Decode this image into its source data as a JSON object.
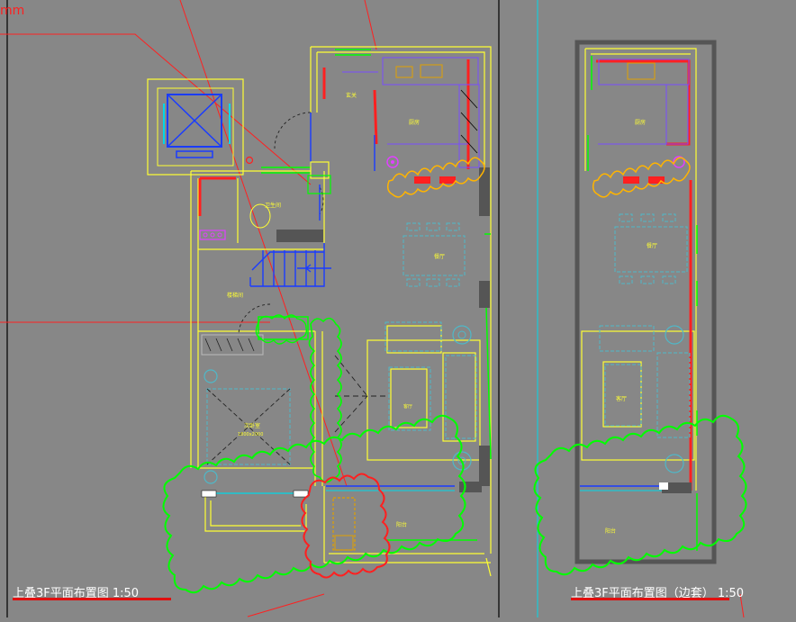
{
  "labels": {
    "top_left_unit": "mm",
    "plan_left_title": "上叠3F平面布置图  1:50",
    "plan_right_title": "上叠3F平面布置图（边套）  1:50",
    "rooms": {
      "xuanguan": "玄关",
      "kitchen": "厨房",
      "bathroom": "卫生间",
      "dining": "餐厅",
      "hall": "楼梯间",
      "bedroom": "次卧室",
      "bed_size": "1800x2000",
      "living_short": "客厅",
      "balcony": "阳台"
    },
    "right_rooms": {
      "kitchen": "厨房",
      "dining": "餐厅",
      "living": "客厅",
      "balcony": "阳台"
    }
  },
  "colors": {
    "background": "#878787",
    "wall_yellow": "#ffff33",
    "wall_red": "#ff2020",
    "green": "#00ff00",
    "cyan": "#00d8e8",
    "blue": "#1a3cff",
    "teal": "#4fb8c8",
    "orange": "#ffb400",
    "magenta": "#e040ff",
    "white": "#ffffff"
  }
}
